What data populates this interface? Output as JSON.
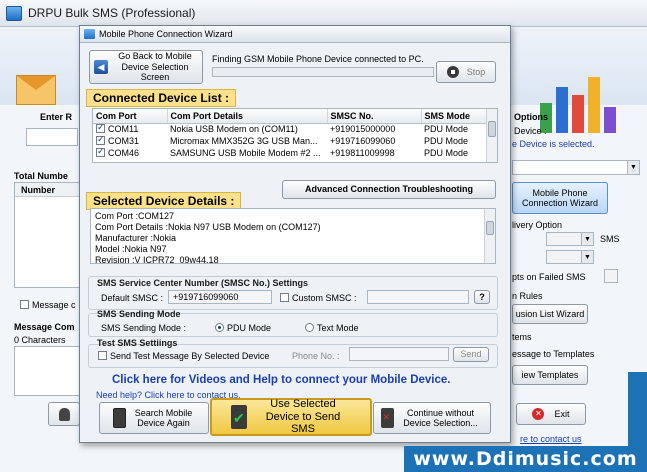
{
  "main_window": {
    "title": "DRPU Bulk SMS (Professional)",
    "left_labels": {
      "enter": "Enter R",
      "total_numbers": "Total Numbe",
      "number_col": "Number",
      "message": "Message c",
      "message_comp": "Message Com",
      "characters": "0 Characters"
    },
    "right_labels": {
      "options": "Options",
      "device": "Device :",
      "device_selected": "e Device is selected.",
      "mobile_phone_wizard": "Mobile Phone Connection  Wizard",
      "delivery_option": "livery Option",
      "sms": "SMS",
      "pts_failed": "pts on Failed SMS",
      "rules": "n Rules",
      "list_wizard": "usion List Wizard",
      "items": "tems",
      "message_templates": "essage to Templates",
      "view_templates": "iew Templates",
      "exit": "Exit",
      "contact": "re to contact us"
    }
  },
  "dialog": {
    "title": "Mobile Phone Connection Wizard",
    "go_back_button": "Go Back to Mobile Device Selection Screen",
    "status_text": "Finding GSM Mobile Phone Device connected to PC.",
    "stop_button": "Stop",
    "connected_label": "Connected Device List :",
    "columns": [
      "Com Port",
      "Com Port Details",
      "SMSC No.",
      "SMS Mode"
    ],
    "devices": [
      {
        "port": "COM11",
        "details": "Nokia USB Modem on (COM11)",
        "smsc": "+919015000000",
        "mode": "PDU Mode"
      },
      {
        "port": "COM31",
        "details": "Micromax MMX352G 3G USB Man...",
        "smsc": "+919716099060",
        "mode": "PDU Mode"
      },
      {
        "port": "COM46",
        "details": "SAMSUNG USB Mobile Modem #2 ...",
        "smsc": "+919811009998",
        "mode": "PDU Mode"
      }
    ],
    "advanced_button": "Advanced Connection Troubleshooting",
    "selected_label": "Selected Device Details :",
    "details": {
      "line1": "Com Port :COM127",
      "line2": "Com Port Details :Nokia N97 USB Modem on (COM127)",
      "line3": "Manufacturer :Nokia",
      "line4": "Model :Nokia N97",
      "line5": "Revision :V ICPR72_09w44.18"
    },
    "smsc_group": {
      "title": "SMS Service Center Number (SMSC No.) Settings",
      "default_label": "Default SMSC :",
      "default_value": "+919716099060",
      "custom_label": "Custom SMSC :",
      "help": "?"
    },
    "mode_group": {
      "title": "SMS Sending Mode",
      "label": "SMS Sending Mode :",
      "pdu": "PDU Mode",
      "text": "Text Mode"
    },
    "test_group": {
      "title": "Test SMS Settiings",
      "send_test_label": "Send Test Message By Selected Device",
      "phone_label": "Phone No. :",
      "send_button": "Send"
    },
    "help_link": "Click here for Videos and Help to connect your Mobile Device.",
    "need_help": "Need help? Click here to contact us.",
    "search_button": "Search Mobile Device Again",
    "use_button": "Use Selected Device to Send SMS",
    "continue_button": "Continue without Device Selection..."
  },
  "watermark": "www.Ddimusic.com",
  "colors": {
    "highlight_label": "#fbe28a",
    "link_blue": "#1a3fb0",
    "watermark": "#1d72b6"
  }
}
